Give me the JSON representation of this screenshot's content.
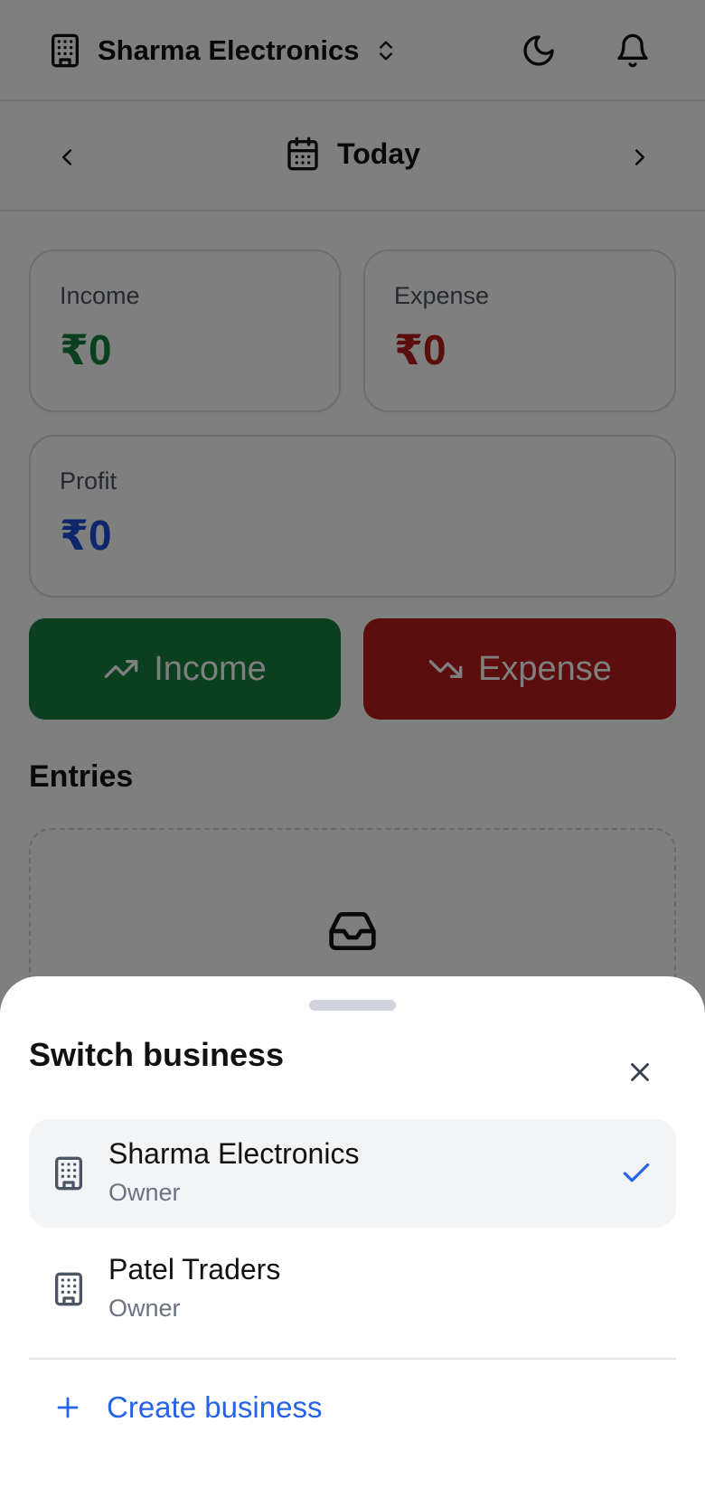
{
  "header": {
    "business_name": "Sharma Electronics"
  },
  "datebar": {
    "label": "Today"
  },
  "summary": {
    "income": {
      "label": "Income",
      "value": "₹0",
      "color": "#15803d"
    },
    "expense": {
      "label": "Expense",
      "value": "₹0",
      "color": "#b91c1c"
    },
    "profit": {
      "label": "Profit",
      "value": "₹0",
      "color": "#1d4ed8"
    }
  },
  "actions": {
    "income_label": "Income",
    "expense_label": "Expense"
  },
  "entries": {
    "title": "Entries"
  },
  "sheet": {
    "title": "Switch business",
    "businesses": [
      {
        "name": "Sharma Electronics",
        "role": "Owner",
        "selected": true
      },
      {
        "name": "Patel Traders",
        "role": "Owner",
        "selected": false
      }
    ],
    "create_label": "Create business"
  },
  "icons": {
    "building": "building-icon",
    "chevrons": "chevrons-up-down-icon",
    "moon": "moon-icon",
    "bell": "bell-icon",
    "calendar": "calendar-icon",
    "inbox": "inbox-icon",
    "close": "close-icon",
    "check": "check-icon",
    "plus": "plus-icon",
    "trend_up": "trending-up-icon",
    "trend_down": "trending-down-icon"
  },
  "colors": {
    "accent": "#2563eb",
    "income": "#15803d",
    "expense": "#b91c1c",
    "profit": "#1d4ed8"
  }
}
